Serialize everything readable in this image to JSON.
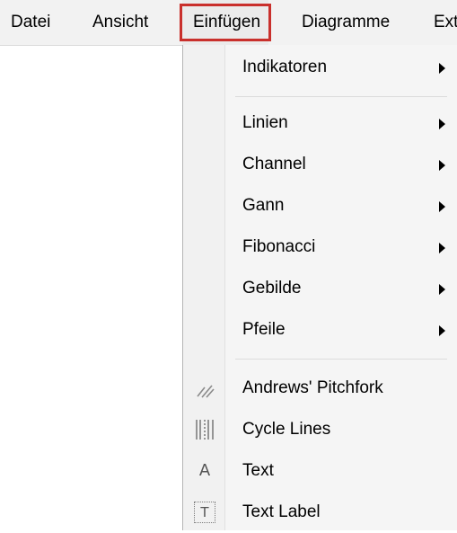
{
  "menubar": {
    "items": [
      {
        "label": "Datei"
      },
      {
        "label": "Ansicht"
      },
      {
        "label": "Einfügen"
      },
      {
        "label": "Diagramme"
      },
      {
        "label": "Ext"
      }
    ]
  },
  "dropdown": {
    "items": [
      {
        "label": "Indikatoren",
        "submenu": true
      },
      {
        "label": "Linien",
        "submenu": true
      },
      {
        "label": "Channel",
        "submenu": true
      },
      {
        "label": "Gann",
        "submenu": true
      },
      {
        "label": "Fibonacci",
        "submenu": true
      },
      {
        "label": "Gebilde",
        "submenu": true
      },
      {
        "label": "Pfeile",
        "submenu": true
      },
      {
        "label": "Andrews' Pitchfork",
        "icon": "pitchfork-icon"
      },
      {
        "label": "Cycle Lines",
        "icon": "cycle-lines-icon"
      },
      {
        "label": "Text",
        "icon": "text-icon",
        "icon_glyph": "A"
      },
      {
        "label": "Text Label",
        "icon": "text-label-icon",
        "icon_glyph": "T"
      }
    ]
  },
  "colors": {
    "highlight_border": "#c9302c",
    "menu_background": "#f5f5f5",
    "menubar_background": "#f2f2f2"
  }
}
